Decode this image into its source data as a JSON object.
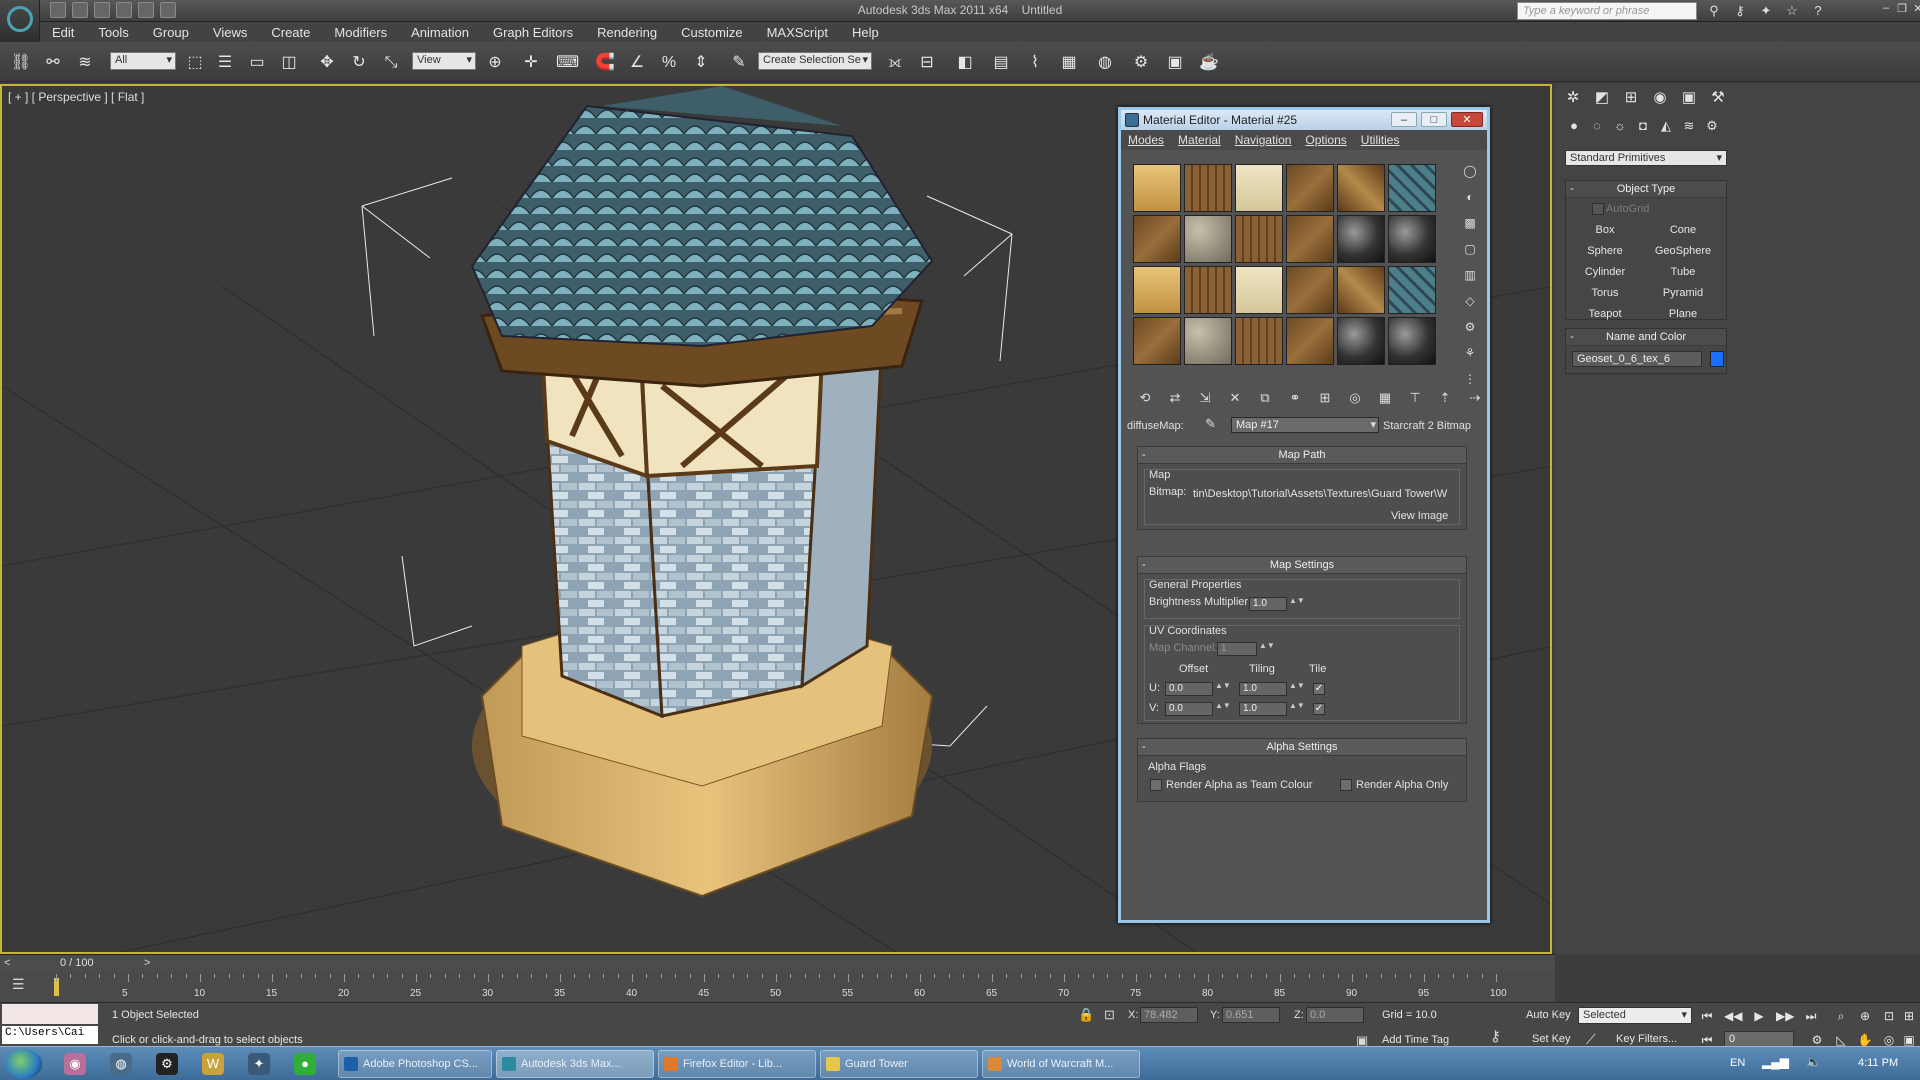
{
  "app": {
    "window_title": "Autodesk 3ds Max 2011 x64",
    "file_title": "Untitled",
    "search_placeholder": "Type a keyword or phrase"
  },
  "menu": [
    "Edit",
    "Tools",
    "Group",
    "Views",
    "Create",
    "Modifiers",
    "Animation",
    "Graph Editors",
    "Rendering",
    "Customize",
    "MAXScript",
    "Help"
  ],
  "toolbar": {
    "selection_filter": "All",
    "ref_coord": "View",
    "named_selection": "Create Selection Se"
  },
  "viewport": {
    "label": "[ + ] [ Perspective ] [ Flat ]"
  },
  "material_editor": {
    "title": "Material Editor - Material #25",
    "menus": [
      "Modes",
      "Material",
      "Navigation",
      "Options",
      "Utilities"
    ],
    "diffuse_label": "diffuseMap:",
    "map_name": "Map #17",
    "map_type": "Starcraft 2 Bitmap",
    "map_path_rollout": {
      "title": "Map Path",
      "group": "Map",
      "bitmap_label": "Bitmap:",
      "bitmap_path": "tin\\Desktop\\Tutorial\\Assets\\Textures\\Guard Tower\\W",
      "view_image": "View Image"
    },
    "map_settings_rollout": {
      "title": "Map Settings",
      "general_group": "General Properties",
      "brightness_label": "Brightness Multiplier",
      "brightness_value": "1.0",
      "uv_group": "UV Coordinates",
      "map_channel_label": "Map Channel:",
      "map_channel_value": "1",
      "offset_label": "Offset",
      "tiling_label": "Tiling",
      "tile_label": "Tile",
      "u_label": "U:",
      "v_label": "V:",
      "u_offset": "0.0",
      "v_offset": "0.0",
      "u_tiling": "1.0",
      "v_tiling": "1.0",
      "u_tile": true,
      "v_tile": true
    },
    "alpha_rollout": {
      "title": "Alpha Settings",
      "group": "Alpha Flags",
      "team_colour": "Render Alpha as Team Colour",
      "alpha_only": "Render Alpha Only"
    }
  },
  "command_panel": {
    "category": "Standard Primitives",
    "object_type_title": "Object Type",
    "autogrid": "AutoGrid",
    "buttons": [
      "Box",
      "Cone",
      "Sphere",
      "GeoSphere",
      "Cylinder",
      "Tube",
      "Torus",
      "Pyramid",
      "Teapot",
      "Plane"
    ],
    "name_color_title": "Name and Color",
    "object_name": "Geoset_0_6_tex_6",
    "object_color": "#1a6fff"
  },
  "time": {
    "frame_display": "0 / 100",
    "ticks": [
      "5",
      "10",
      "15",
      "20",
      "25",
      "30",
      "35",
      "40",
      "45",
      "50",
      "55",
      "60",
      "65",
      "70",
      "75",
      "80",
      "85",
      "90",
      "95",
      "100"
    ]
  },
  "status": {
    "maxscript_text": "C:\\Users\\Cai",
    "selection": "1 Object Selected",
    "prompt": "Click or click-and-drag to select objects",
    "x_label": "X:",
    "y_label": "Y:",
    "z_label": "Z:",
    "x_value": "78.482",
    "y_value": "0.651",
    "z_value": "0.0",
    "grid": "Grid = 10.0",
    "add_time_tag": "Add Time Tag",
    "auto_key": "Auto Key",
    "set_key": "Set Key",
    "key_mode": "Selected",
    "key_filters": "Key Filters...",
    "current_frame": "0"
  },
  "taskbar": {
    "items": [
      "Adobe Photoshop CS...",
      "Autodesk 3ds Max...",
      "Firefox Editor - Lib...",
      "Guard Tower",
      "World of Warcraft M..."
    ],
    "tray": "EN",
    "clock": "4:11 PM"
  }
}
